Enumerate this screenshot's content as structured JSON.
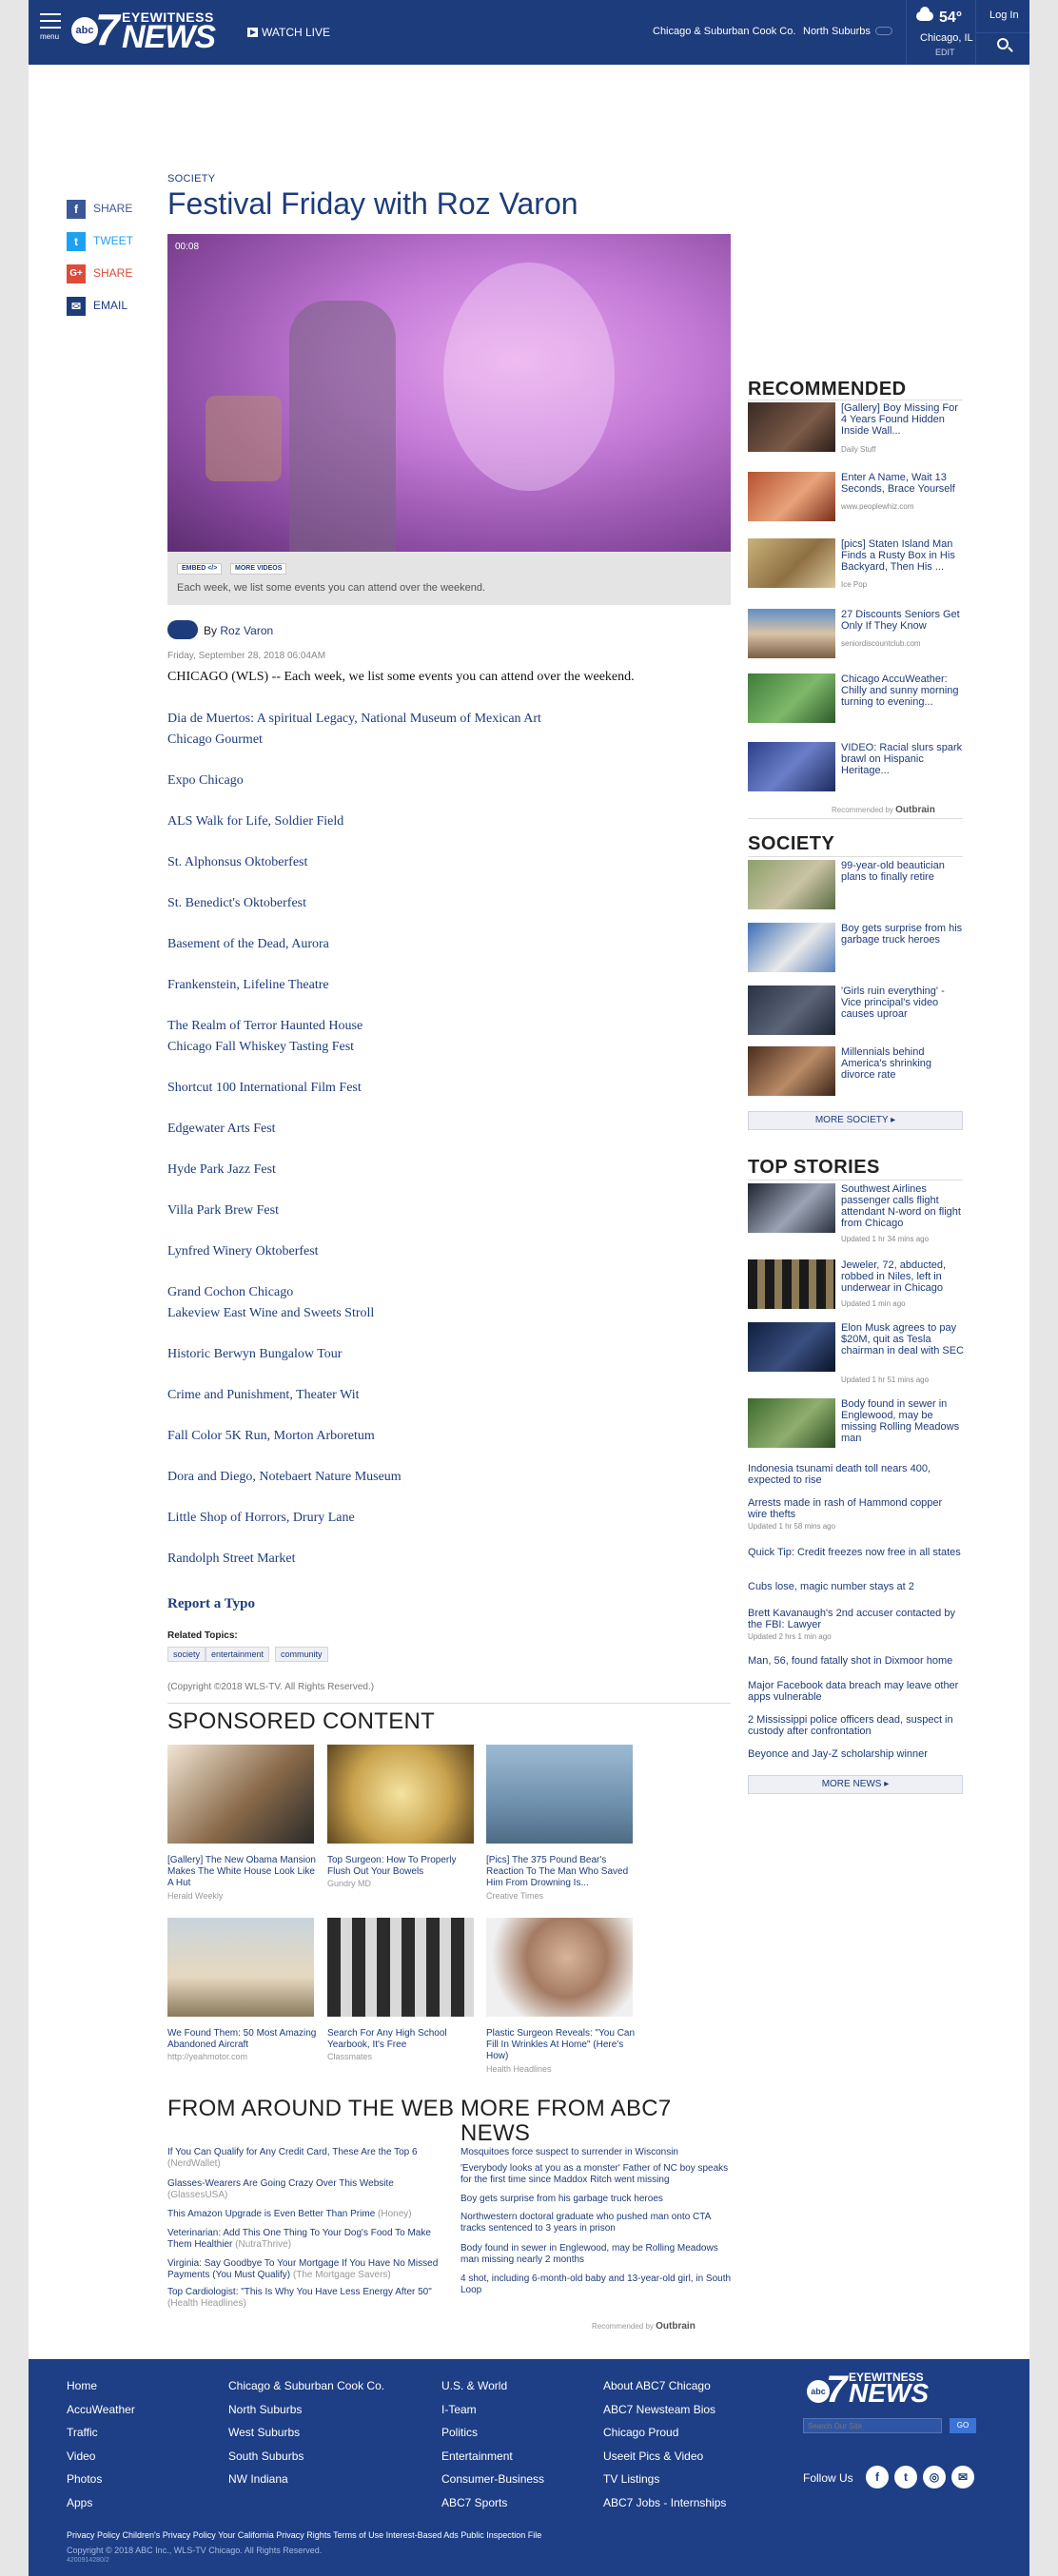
{
  "header": {
    "menu_label": "menu",
    "logo_abc": "abc",
    "logo_seven": "7",
    "logo_word1": "EYEWITNESS",
    "logo_word2": "NEWS",
    "watch_live": "WATCH LIVE",
    "location1": "Chicago & Suburban Cook Co.",
    "location2": "North Suburbs",
    "weather_temp": "54°",
    "weather_city": "Chicago, IL",
    "weather_tz": "EDIT",
    "login": "Log In"
  },
  "share": {
    "facebook": "SHARE",
    "twitter": "TWEET",
    "google": "SHARE",
    "email": "EMAIL"
  },
  "article": {
    "kicker": "SOCIETY",
    "headline": "Festival Friday with Roz Varon",
    "video_time": "00:08",
    "embed": "EMBED </>",
    "more_videos": "MORE VIDEOS",
    "caption": "Each week, we list some events you can attend over the weekend.",
    "by": "By",
    "author": "Roz Varon",
    "date": "Friday, September 28, 2018 06:04AM",
    "lede": "CHICAGO (WLS) -- Each week, we list some events you can attend over the weekend.",
    "events": [
      "Dia de Muertos: A spiritual Legacy, National Museum of Mexican Art",
      "Chicago Gourmet",
      "Expo Chicago",
      "ALS Walk for Life, Soldier Field",
      "St. Alphonsus Oktoberfest",
      "St. Benedict's Oktoberfest",
      "Basement of the Dead, Aurora",
      "Frankenstein, Lifeline Theatre",
      "The Realm of Terror Haunted House",
      "Chicago Fall Whiskey Tasting Fest",
      "Shortcut 100 International Film Fest",
      "Edgewater Arts Fest",
      "Hyde Park Jazz Fest",
      "Villa Park Brew Fest",
      "Lynfred Winery Oktoberfest",
      "Grand Cochon Chicago",
      "Lakeview East Wine and Sweets Stroll",
      "Historic Berwyn Bungalow Tour",
      "Crime and Punishment, Theater Wit",
      "Fall Color 5K Run, Morton Arboretum",
      "Dora and Diego, Notebaert Nature Museum",
      "Little Shop of Horrors, Drury Lane",
      "Randolph Street Market"
    ],
    "report_typo": "Report a Typo",
    "related_title": "Related Topics:",
    "tags": [
      "society",
      "entertainment",
      "community"
    ],
    "copyright": "(Copyright ©2018 WLS-TV. All Rights Reserved.)"
  },
  "sponsored": {
    "heading": "SPONSORED CONTENT",
    "items": [
      {
        "title": "[Gallery] The New Obama Mansion Makes The White House Look Like A Hut",
        "source": "Herald Weekly"
      },
      {
        "title": "Top Surgeon: How To Properly Flush Out Your Bowels",
        "source": "Gundry MD"
      },
      {
        "title": "[Pics] The 375 Pound Bear's Reaction To The Man Who Saved Him From Drowning Is...",
        "source": "Creative Times"
      },
      {
        "title": "We Found Them: 50 Most Amazing Abandoned Aircraft",
        "source": "http://yeahmotor.com"
      },
      {
        "title": "Search For Any High School Yearbook, It's Free",
        "source": "Classmates"
      },
      {
        "title": "Plastic Surgeon Reveals: \"You Can Fill In Wrinkles At Home\" (Here's How)",
        "source": "Health Headlines"
      }
    ]
  },
  "from_web": {
    "heading": "FROM AROUND THE WEB",
    "items": [
      {
        "title": "If You Can Qualify for Any Credit Card, These Are the Top 6",
        "source": "(NerdWallet)"
      },
      {
        "title": "Glasses-Wearers Are Going Crazy Over This Website",
        "source": "(GlassesUSA)"
      },
      {
        "title": "This Amazon Upgrade is Even Better Than Prime",
        "source": "(Honey)"
      },
      {
        "title": "Veterinarian: Add This One Thing To Your Dog's Food To Make Them Healthier",
        "source": "(NutraThrive)"
      },
      {
        "title": "Virginia: Say Goodbye To Your Mortgage If You Have No Missed Payments (You Must Qualify)",
        "source": "(The Mortgage Savers)"
      },
      {
        "title": "Top Cardiologist: \"This Is Why You Have Less Energy After 50\"",
        "source": "(Health Headlines)"
      }
    ]
  },
  "more_from": {
    "heading_line1": "MORE FROM ABC7",
    "heading_line2": "NEWS",
    "items": [
      "Mosquitoes force suspect to surrender in Wisconsin",
      "'Everybody looks at you as a monster' Father of NC boy speaks for the first time since Maddox Ritch went missing",
      "Boy gets surprise from his garbage truck heroes",
      "Northwestern doctoral graduate who pushed man onto CTA tracks sentenced to 3 years in prison",
      "Body found in sewer in Englewood, may be Rolling Meadows man missing nearly 2 months",
      "4 shot, including 6-month-old baby and 13-year-old girl, in South Loop"
    ],
    "recommended_by": "Recommended by",
    "outbrain": "Outbrain"
  },
  "recommended": {
    "heading": "RECOMMENDED",
    "items": [
      {
        "title": "[Gallery] Boy Missing For 4 Years Found Hidden Inside Wall...",
        "source": "Daily Stuff"
      },
      {
        "title": "Enter A Name, Wait 13 Seconds, Brace Yourself",
        "source": "www.peoplewhiz.com"
      },
      {
        "title": "[pics] Staten Island Man Finds a Rusty Box in His Backyard, Then His ...",
        "source": "Ice Pop"
      },
      {
        "title": "27 Discounts Seniors Get Only If They Know",
        "source": "seniordiscountclub.com"
      },
      {
        "title": "Chicago AccuWeather: Chilly and sunny morning turning to evening...",
        "source": ""
      },
      {
        "title": "VIDEO: Racial slurs spark brawl on Hispanic Heritage...",
        "source": ""
      }
    ],
    "recommended_by": "Recommended by",
    "outbrain": "Outbrain"
  },
  "society": {
    "heading": "SOCIETY",
    "items": [
      "99-year-old beautician plans to finally retire",
      "Boy gets surprise from his garbage truck heroes",
      "'Girls ruin everything' - Vice principal's video causes uproar",
      "Millennials behind America's shrinking divorce rate"
    ],
    "more": "MORE SOCIETY"
  },
  "top_stories": {
    "heading": "TOP STORIES",
    "with_image": [
      {
        "title": "Southwest Airlines passenger calls flight attendant N-word on flight from Chicago",
        "updated": "Updated 1 hr 34 mins ago"
      },
      {
        "title": "Jeweler, 72, abducted, robbed in Niles, left in underwear in Chicago",
        "updated": "Updated 1 min ago"
      },
      {
        "title": "Elon Musk agrees to pay $20M, quit as Tesla chairman in deal with SEC",
        "updated": "Updated 1 hr 51 mins ago"
      },
      {
        "title": "Body found in sewer in Englewood, may be missing Rolling Meadows man",
        "updated": ""
      }
    ],
    "text_items": [
      {
        "title": "Indonesia tsunami death toll nears 400, expected to rise",
        "updated": ""
      },
      {
        "title": "Arrests made in rash of Hammond copper wire thefts",
        "updated": "Updated 1 hr 58 mins ago"
      },
      {
        "title": "Quick Tip: Credit freezes now free in all states",
        "updated": ""
      },
      {
        "title": "Cubs lose, magic number stays at 2",
        "updated": ""
      },
      {
        "title": "Brett Kavanaugh's 2nd accuser contacted by the FBI: Lawyer",
        "updated": "Updated 2 hrs 1 min ago"
      },
      {
        "title": "Man, 56, found fatally shot in Dixmoor home",
        "updated": ""
      },
      {
        "title": "Major Facebook data breach may leave other apps vulnerable",
        "updated": ""
      },
      {
        "title": "2 Mississippi police officers dead, suspect in custody after confrontation",
        "updated": ""
      },
      {
        "title": "Beyonce and Jay-Z scholarship winner",
        "updated": ""
      }
    ],
    "more": "MORE NEWS"
  },
  "footer": {
    "col1": [
      "Home",
      "AccuWeather",
      "Traffic",
      "Video",
      "Photos",
      "Apps"
    ],
    "col2": [
      "Chicago & Suburban Cook Co.",
      "North Suburbs",
      "West Suburbs",
      "South Suburbs",
      "NW Indiana"
    ],
    "col3": [
      "U.S. & World",
      "I-Team",
      "Politics",
      "Entertainment",
      "Consumer-Business",
      "ABC7 Sports"
    ],
    "col4": [
      "About ABC7 Chicago",
      "ABC7 Newsteam Bios",
      "Chicago Proud",
      "Useeit Pics & Video",
      "TV Listings",
      "ABC7 Jobs - Internships"
    ],
    "search_placeholder": "Search Our Site",
    "go": "GO",
    "follow": "Follow Us",
    "legal": "Privacy Policy    Children's Privacy Policy    Your California Privacy Rights    Terms of Use    Interest-Based Ads    Public Inspection File",
    "copyright": "Copyright © 2018 ABC Inc., WLS-TV Chicago. All Rights Reserved.",
    "video_id": "4200914280/2"
  },
  "colors": {
    "brand": "#1d3c7c",
    "footer": "#1e3f86",
    "facebook": "#3b5998",
    "twitter": "#1da1f2",
    "google": "#dd4b39"
  }
}
